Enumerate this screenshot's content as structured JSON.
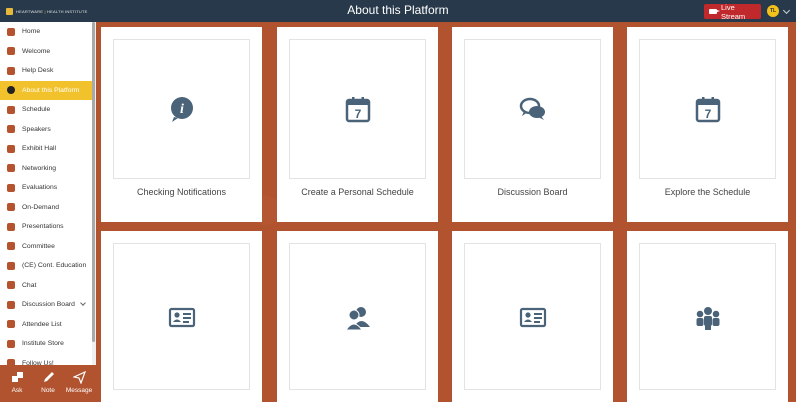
{
  "header": {
    "logo_text_left": "HEARTWARE",
    "logo_text_sep": "|",
    "logo_text_right": "HEALTH INSTITUTE",
    "title": "About this Platform",
    "live_stream_label": "Live Stream",
    "avatar_initials": "TL"
  },
  "sidebar": {
    "items": [
      {
        "label": "Home",
        "icon": "home-icon"
      },
      {
        "label": "Welcome",
        "icon": "envelope-icon"
      },
      {
        "label": "Help Desk",
        "icon": "chat-bubble-icon"
      },
      {
        "label": "About this Platform",
        "icon": "info-icon"
      },
      {
        "label": "Schedule",
        "icon": "calendar-icon"
      },
      {
        "label": "Speakers",
        "icon": "users-icon"
      },
      {
        "label": "Exhibit Hall",
        "icon": "binoculars-icon"
      },
      {
        "label": "Networking",
        "icon": "handshake-icon"
      },
      {
        "label": "Evaluations",
        "icon": "clipboard-icon"
      },
      {
        "label": "On-Demand",
        "icon": "monitor-icon"
      },
      {
        "label": "Presentations",
        "icon": "book-icon"
      },
      {
        "label": "Committee",
        "icon": "group-icon"
      },
      {
        "label": "(CE) Cont. Education",
        "icon": "certificate-icon"
      },
      {
        "label": "Chat",
        "icon": "speech-icon"
      },
      {
        "label": "Discussion Board",
        "icon": "comments-icon"
      },
      {
        "label": "Attendee List",
        "icon": "person-icon"
      },
      {
        "label": "Institute Store",
        "icon": "store-icon"
      },
      {
        "label": "Follow Us!",
        "icon": "share-icon"
      }
    ],
    "active_index": 3
  },
  "actions": [
    {
      "label": "Ask",
      "icon": "puzzle-icon"
    },
    {
      "label": "Note",
      "icon": "pen-icon"
    },
    {
      "label": "Message",
      "icon": "paper-plane-icon"
    }
  ],
  "cards": [
    {
      "title": "Checking Notifications",
      "icon": "info-bubble-icon"
    },
    {
      "title": "Create a Personal Schedule",
      "icon": "calendar-7-icon"
    },
    {
      "title": "Discussion Board",
      "icon": "speech-bubbles-icon"
    },
    {
      "title": "Explore the Schedule",
      "icon": "calendar-7-icon"
    },
    {
      "title": "",
      "icon": "id-card-icon"
    },
    {
      "title": "",
      "icon": "users-icon"
    },
    {
      "title": "",
      "icon": "id-card-icon"
    },
    {
      "title": "",
      "icon": "group-icon"
    }
  ],
  "colors": {
    "topbar": "#27394a",
    "accent": "#f1c22b",
    "background": "#b1532f",
    "icon": "#4a6378",
    "live": "#c0292b"
  }
}
